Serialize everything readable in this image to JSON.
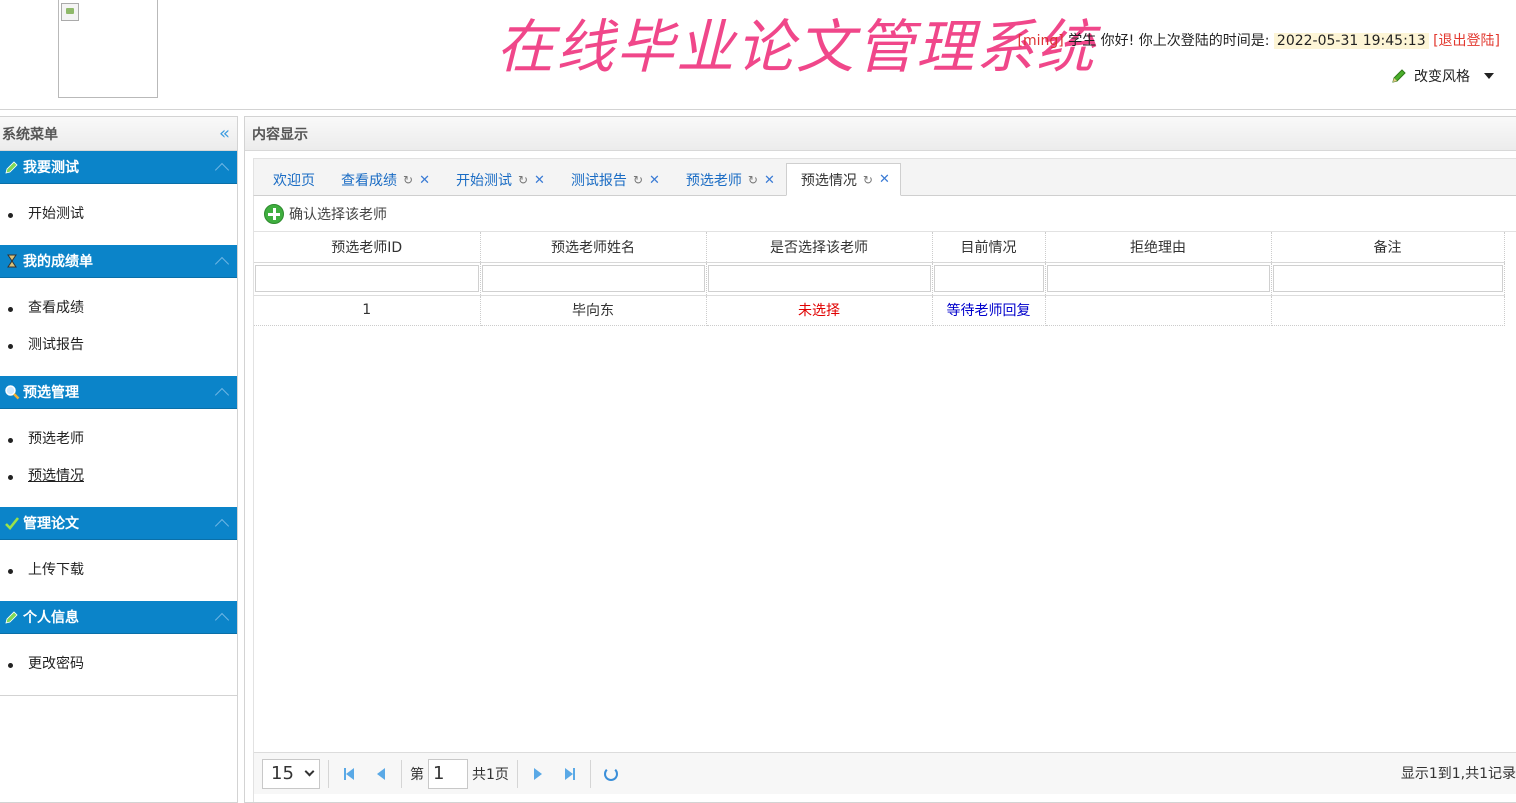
{
  "header": {
    "title": "在线毕业论文管理系统",
    "user_name": "[ming]",
    "greeting": " 学生 你好! 你上次登陆的时间是: ",
    "last_login": "2022-05-31 19:45:13",
    "logout": "[退出登陆]",
    "style_switch": "改变风格"
  },
  "sidebar": {
    "title": "系统菜单",
    "groups": [
      {
        "title": "我要测试",
        "icon": "pencil-icon",
        "items": [
          {
            "label": "开始测试"
          }
        ]
      },
      {
        "title": "我的成绩单",
        "icon": "hourglass-icon",
        "items": [
          {
            "label": "查看成绩"
          },
          {
            "label": "测试报告"
          }
        ]
      },
      {
        "title": "预选管理",
        "icon": "magnifier-icon",
        "items": [
          {
            "label": "预选老师"
          },
          {
            "label": "预选情况",
            "active": true
          }
        ]
      },
      {
        "title": "管理论文",
        "icon": "checkmark-icon",
        "items": [
          {
            "label": "上传下载"
          }
        ]
      },
      {
        "title": "个人信息",
        "icon": "pencil-icon",
        "items": [
          {
            "label": "更改密码"
          }
        ]
      }
    ]
  },
  "main": {
    "title": "内容显示",
    "tabs": [
      {
        "label": "欢迎页",
        "closable": false
      },
      {
        "label": "查看成绩",
        "closable": true
      },
      {
        "label": "开始测试",
        "closable": true
      },
      {
        "label": "测试报告",
        "closable": true
      },
      {
        "label": "预选老师",
        "closable": true
      },
      {
        "label": "预选情况",
        "closable": true,
        "active": true
      }
    ],
    "toolbar": {
      "confirm_label": "确认选择该老师"
    },
    "table": {
      "columns": [
        "预选老师ID",
        "预选老师姓名",
        "是否选择该老师",
        "目前情况",
        "拒绝理由",
        "备注"
      ],
      "rows": [
        {
          "id": "1",
          "name": "毕向东",
          "selected": "未选择",
          "status": "等待老师回复",
          "reason": "",
          "note": ""
        }
      ]
    },
    "pager": {
      "page_size": "15",
      "page_prefix": "第",
      "page_value": "1",
      "page_suffix": "共1页",
      "info": "显示1到1,共1记录"
    }
  },
  "colors": {
    "title": "#f0478a",
    "menu_header": "#0b84c9",
    "link": "#1a6cc4",
    "red_status": "#e00000",
    "blue_status": "#0000cc"
  }
}
